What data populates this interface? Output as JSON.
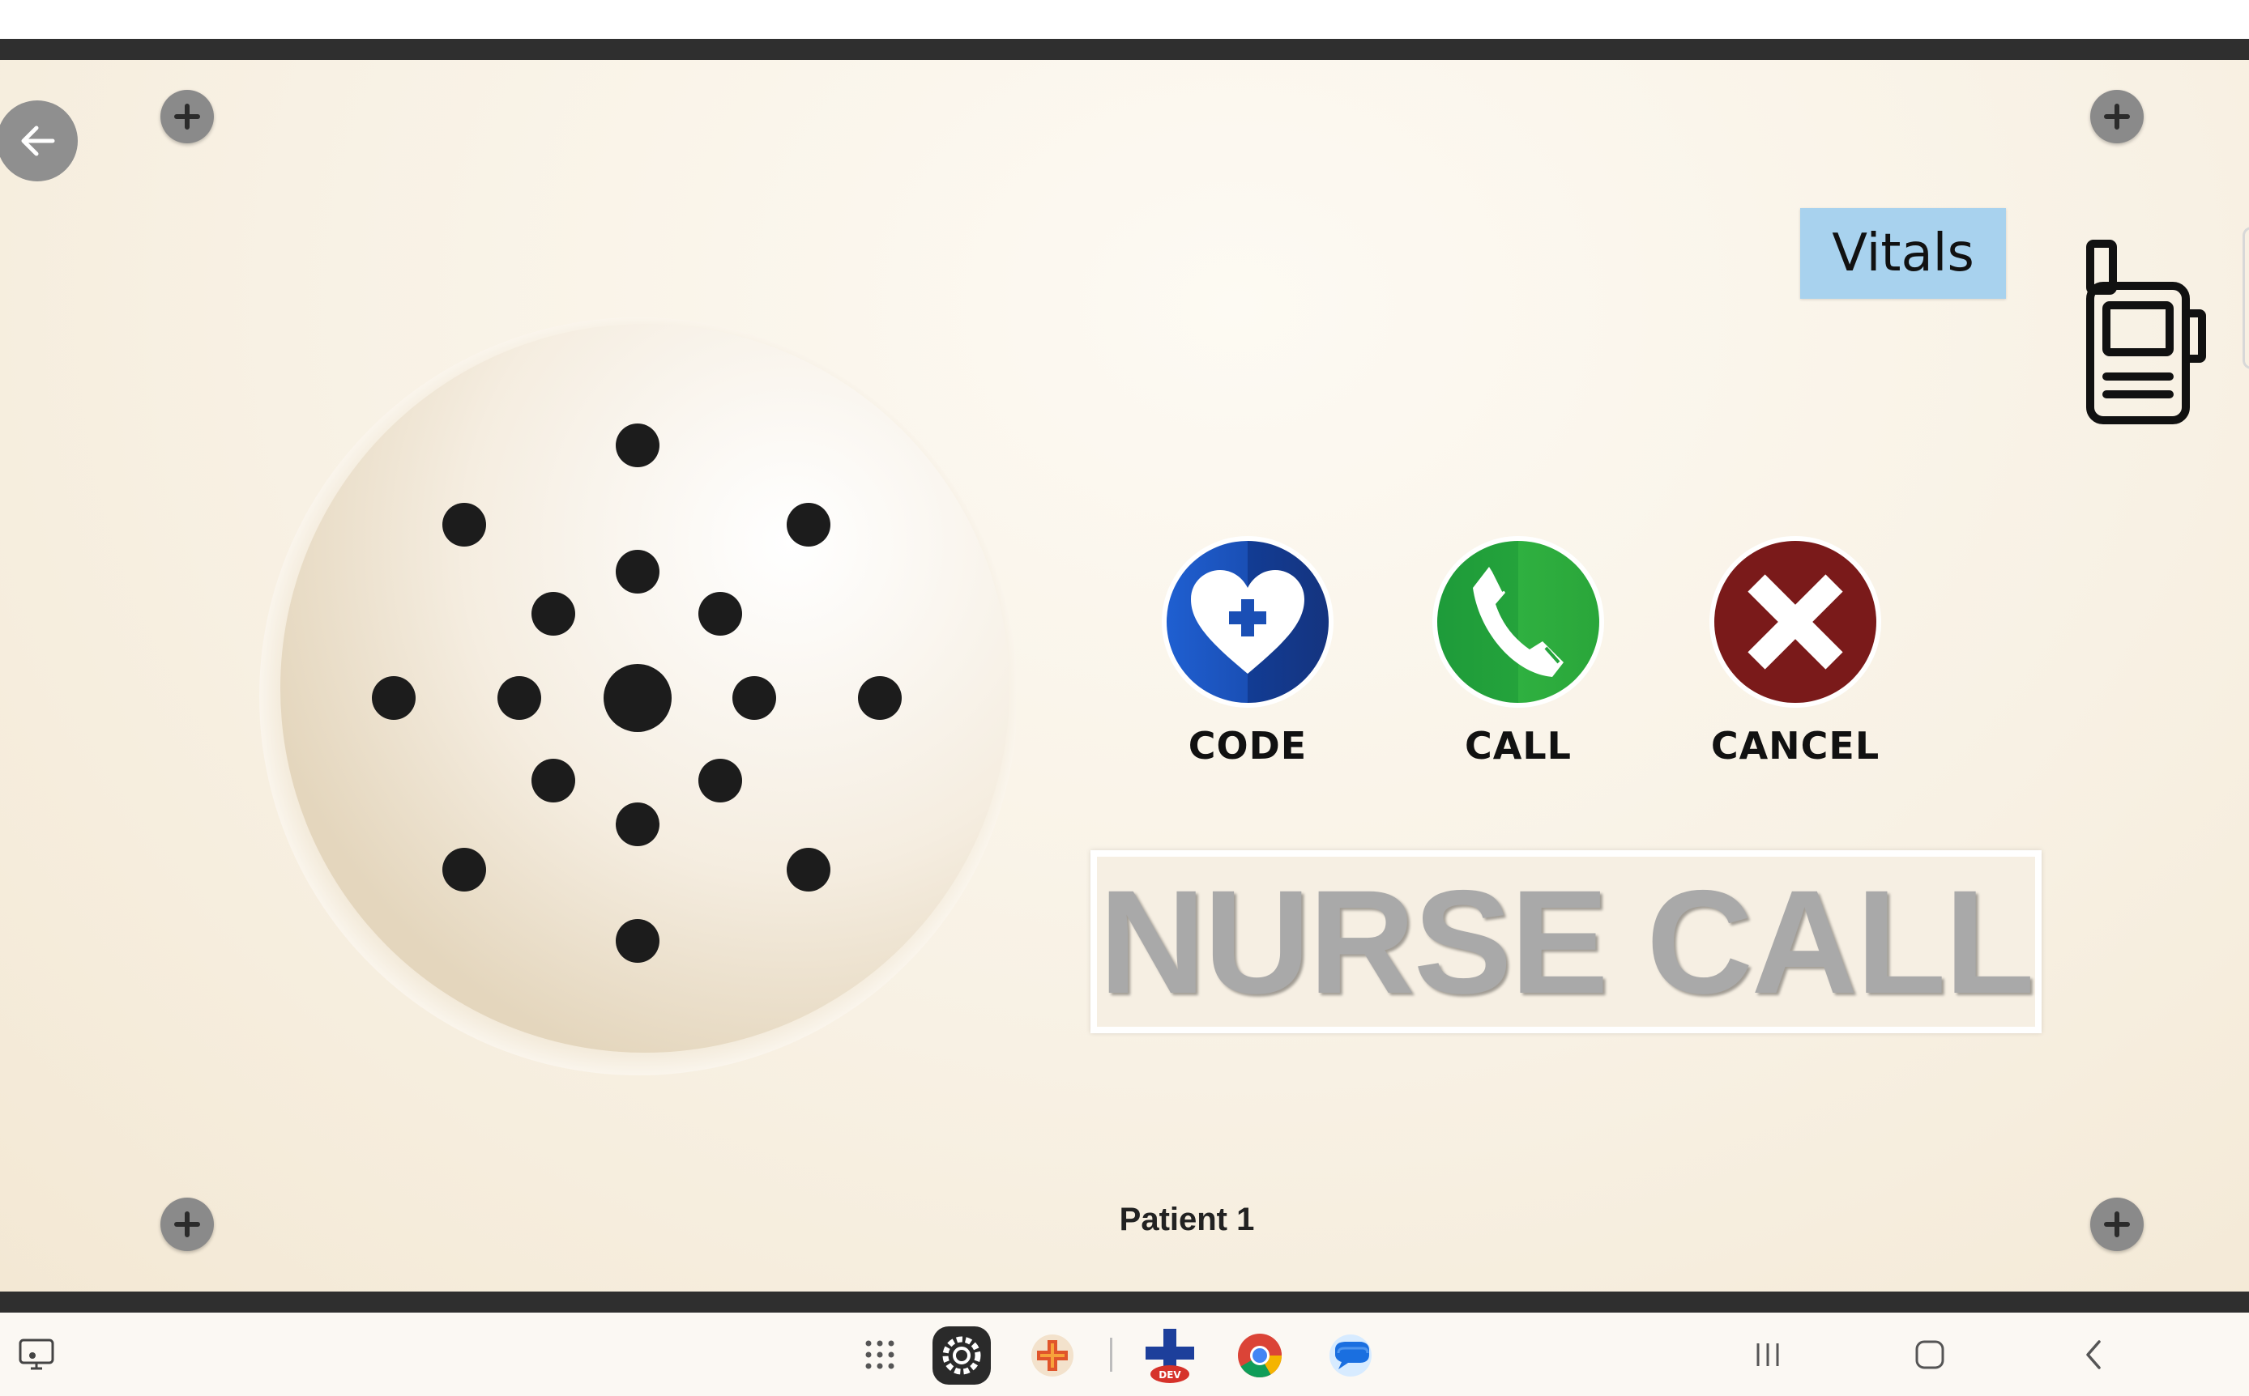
{
  "panel": {
    "vitals_label": "Vitals",
    "sign_text": "NURSE CALL",
    "patient_label": "Patient 1"
  },
  "actions": [
    {
      "id": "code",
      "label": "CODE",
      "icon": "heart-plus-icon",
      "color": "#1a4fb5"
    },
    {
      "id": "call",
      "label": "CALL",
      "icon": "phone-icon",
      "color": "#24a33b"
    },
    {
      "id": "cancel",
      "label": "CANCEL",
      "icon": "x-icon",
      "color": "#7a1a1a"
    }
  ],
  "icons": {
    "back": "back-arrow-icon",
    "corner_add": "plus-icon",
    "radio": "walkie-talkie-icon",
    "speaker": "speaker-grille"
  },
  "taskbar": {
    "apps": [
      "app-drawer-icon",
      "settings-app-icon",
      "medical-app-icon",
      "medical-dev-app-icon",
      "chrome-icon",
      "messages-icon"
    ],
    "dev_badge": "DEV",
    "nav": [
      "recents-icon",
      "home-icon",
      "back-icon"
    ]
  },
  "colors": {
    "frame": "#2f2f2f",
    "vitals_bg": "#a8d2ee",
    "sign_text": "#a9a9a9"
  }
}
